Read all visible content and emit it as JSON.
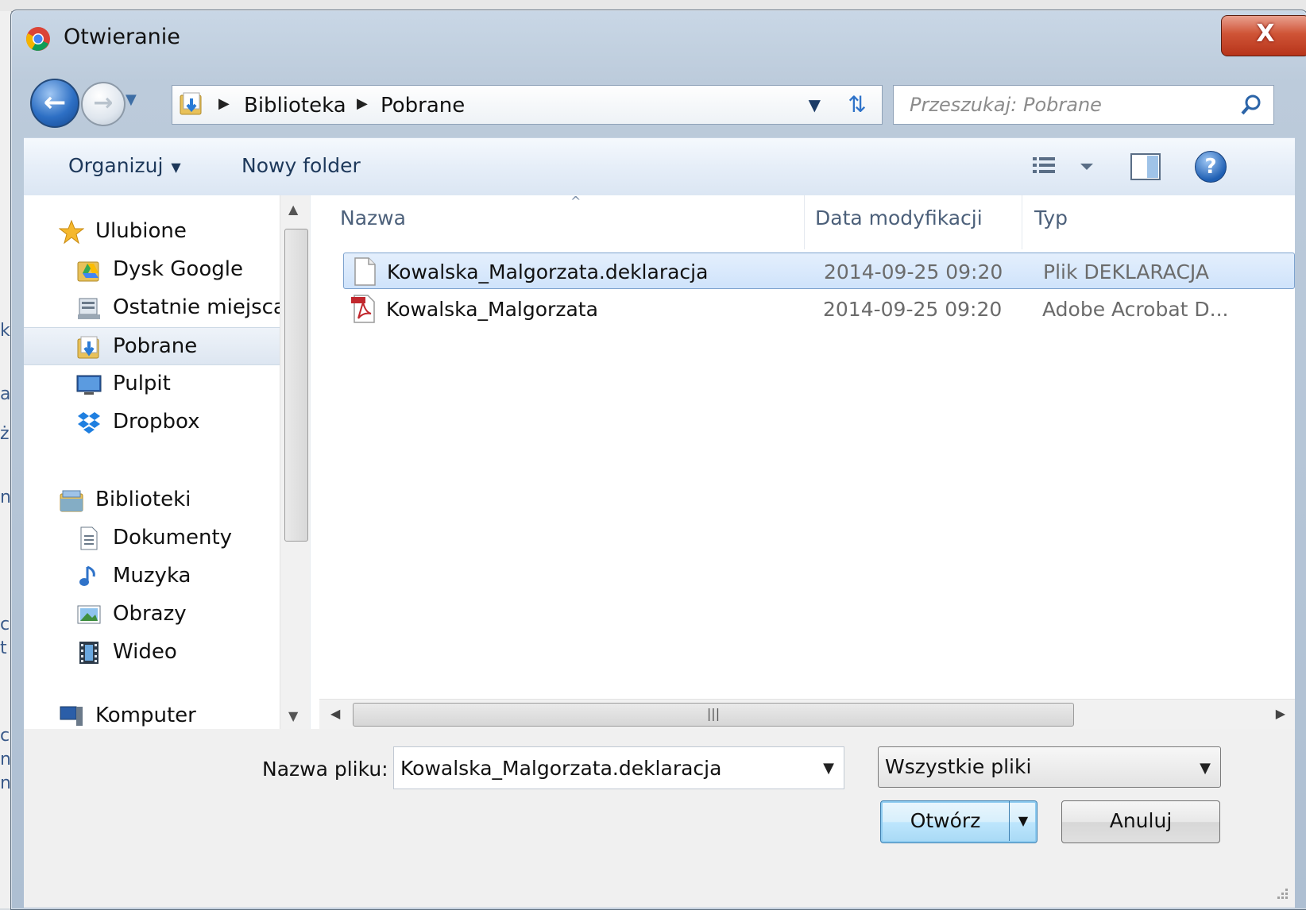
{
  "window": {
    "title": "Otwieranie",
    "close_label": "X"
  },
  "navigation": {
    "breadcrumb": [
      "Biblioteka",
      "Pobrane"
    ],
    "search_placeholder": "Przeszukaj: Pobrane"
  },
  "toolbar": {
    "organize_label": "Organizuj",
    "new_folder_label": "Nowy folder",
    "help_label": "?"
  },
  "sidebar": {
    "items": [
      {
        "label": "Ulubione",
        "icon": "star-icon",
        "level": 0
      },
      {
        "label": "Dysk Google",
        "icon": "google-drive-folder-icon",
        "level": 1
      },
      {
        "label": "Ostatnie miejsca",
        "icon": "recent-places-icon",
        "level": 1
      },
      {
        "label": "Pobrane",
        "icon": "downloads-folder-icon",
        "level": 1,
        "selected": true
      },
      {
        "label": "Pulpit",
        "icon": "desktop-icon",
        "level": 1
      },
      {
        "label": "Dropbox",
        "icon": "dropbox-icon",
        "level": 1
      },
      {
        "label": "Biblioteki",
        "icon": "libraries-icon",
        "level": 0
      },
      {
        "label": "Dokumenty",
        "icon": "documents-icon",
        "level": 1
      },
      {
        "label": "Muzyka",
        "icon": "music-icon",
        "level": 1
      },
      {
        "label": "Obrazy",
        "icon": "pictures-icon",
        "level": 1
      },
      {
        "label": "Wideo",
        "icon": "video-icon",
        "level": 1
      },
      {
        "label": "Komputer",
        "icon": "computer-icon",
        "level": 0
      }
    ]
  },
  "files": {
    "columns": [
      "Nazwa",
      "Data modyfikacji",
      "Typ"
    ],
    "rows": [
      {
        "name": "Kowalska_Malgorzata.deklaracja",
        "date": "2014-09-25 09:20",
        "type": "Plik DEKLARACJA",
        "icon": "blank-file-icon",
        "selected": true
      },
      {
        "name": "Kowalska_Malgorzata",
        "date": "2014-09-25 09:20",
        "type": "Adobe Acrobat D...",
        "icon": "pdf-file-icon",
        "selected": false
      }
    ]
  },
  "footer": {
    "filename_label": "Nazwa pliku:",
    "filename_value": "Kowalska_Malgorzata.deklaracja",
    "filetype_value": "Wszystkie pliki",
    "open_label": "Otwórz",
    "cancel_label": "Anuluj"
  },
  "colors": {
    "selection": "#cfe3fb",
    "toolbar_text": "#1e395b",
    "close_red": "#cf5436"
  }
}
